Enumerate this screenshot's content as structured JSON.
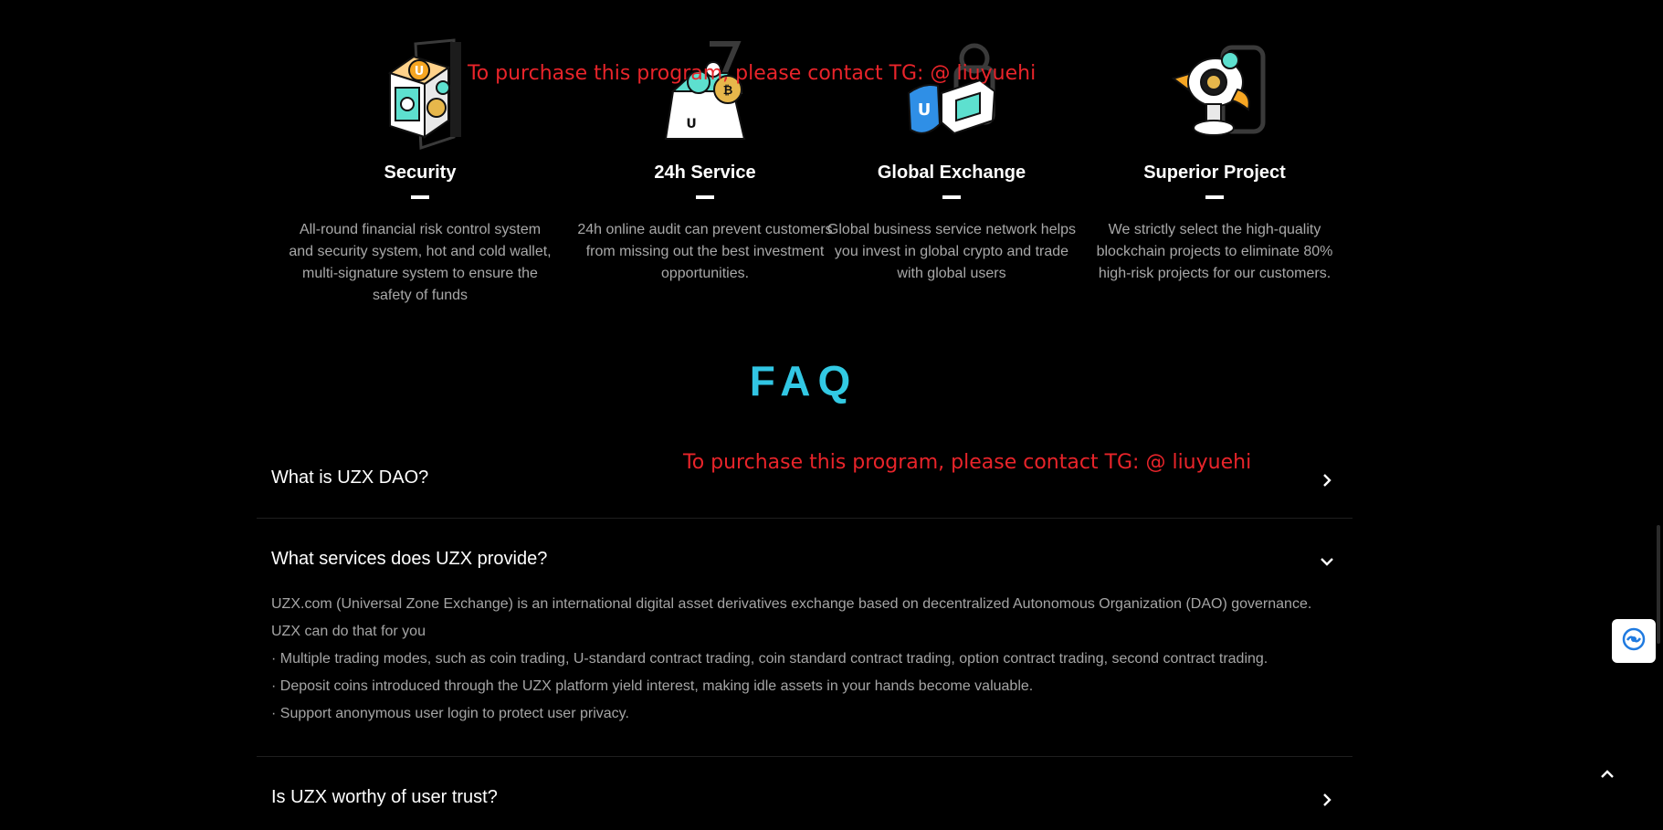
{
  "watermark_text": "To purchase this program, please contact TG: @ liuyuehi",
  "features": [
    {
      "title": "Security",
      "desc": "All-round financial risk control system and security system, hot and cold wallet, multi-signature system to ensure the safety of funds",
      "icon": "safe-vault-icon"
    },
    {
      "title": "24h Service",
      "desc": "24h online audit can prevent customers from missing out the best investment opportunities.",
      "icon": "coin-wallet-icon"
    },
    {
      "title": "Global Exchange",
      "desc": "Global business service network helps you invest in global crypto and trade with global users",
      "icon": "shield-exchange-icon"
    },
    {
      "title": "Superior Project",
      "desc": "We strictly select the high-quality blockchain projects to eliminate 80% high-risk projects for our customers.",
      "icon": "camera-robot-icon"
    }
  ],
  "faq": {
    "title": "FAQ",
    "items": [
      {
        "question": "What is UZX DAO?",
        "expanded": false
      },
      {
        "question": "What services does UZX provide?",
        "expanded": true,
        "answer": [
          "UZX.com (Universal Zone Exchange) is an international digital asset derivatives exchange based on decentralized Autonomous Organization (DAO) governance.",
          "UZX can do that for you",
          "· Multiple trading modes, such as coin trading, U-standard contract trading, coin standard contract trading, option contract trading, second contract trading.",
          "· Deposit coins introduced through the UZX platform yield interest, making idle assets in your hands become valuable.",
          "· Support anonymous user login to protect user privacy."
        ]
      },
      {
        "question": "Is UZX worthy of user trust?",
        "expanded": false
      }
    ]
  },
  "colors": {
    "background": "#000000",
    "accent_gradient": [
      "#2a9df4",
      "#3fe0c8"
    ],
    "watermark": "#e8242a"
  }
}
